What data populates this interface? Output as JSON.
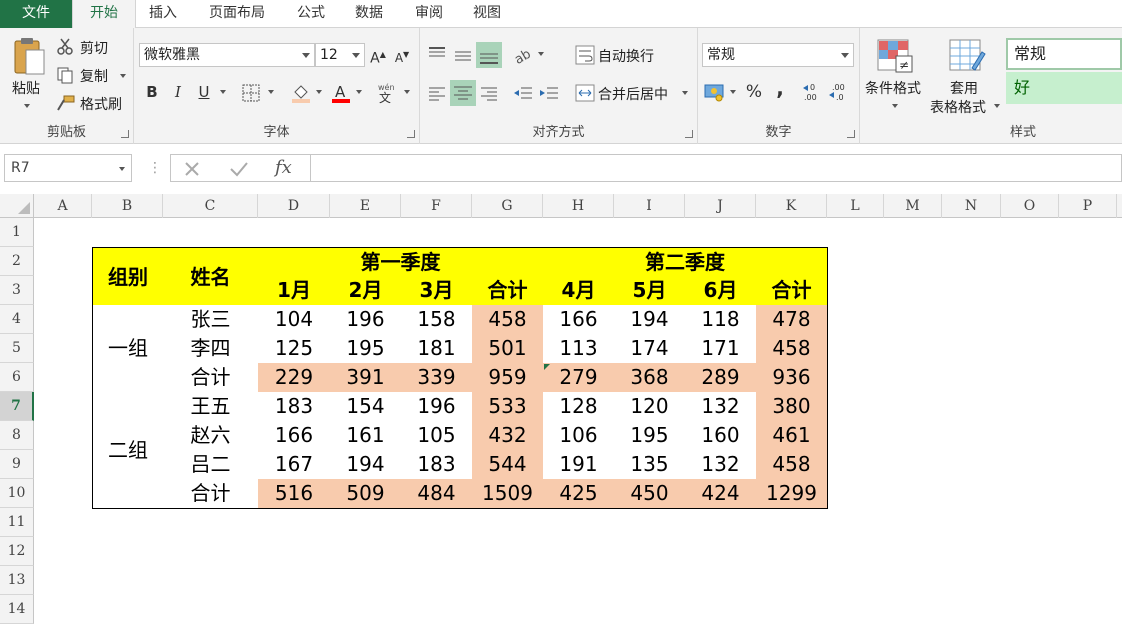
{
  "tabs": [
    "文件",
    "开始",
    "插入",
    "页面布局",
    "公式",
    "数据",
    "审阅",
    "视图"
  ],
  "clipboard": {
    "paste": "粘贴",
    "cut": "剪切",
    "copy": "复制",
    "format_painter": "格式刷",
    "group": "剪贴板"
  },
  "font": {
    "name": "微软雅黑",
    "size": "12",
    "group": "字体",
    "bold": "B",
    "italic": "I",
    "underline": "U"
  },
  "alignment": {
    "wrap": "自动换行",
    "merge": "合并后居中",
    "group": "对齐方式"
  },
  "number": {
    "format": "常规",
    "percent": "%",
    "comma": ",",
    "group": "数字"
  },
  "styles": {
    "conditional": "条件格式",
    "table_fmt_1": "套用",
    "table_fmt_2": "表格格式",
    "normal": "常规",
    "good": "好",
    "group": "样式"
  },
  "formula_bar": {
    "name_box": "R7",
    "fx": "fx",
    "value": ""
  },
  "columns": [
    "A",
    "B",
    "C",
    "D",
    "E",
    "F",
    "G",
    "H",
    "I",
    "J",
    "K",
    "L",
    "M",
    "N",
    "O",
    "P"
  ],
  "rows": [
    "1",
    "2",
    "3",
    "4",
    "5",
    "6",
    "7",
    "8",
    "9",
    "10",
    "11",
    "12",
    "13",
    "14"
  ],
  "active_row": "7",
  "table": {
    "h_group": "组别",
    "h_name": "姓名",
    "q1": "第一季度",
    "q2": "第二季度",
    "months": [
      "1月",
      "2月",
      "3月",
      "合计",
      "4月",
      "5月",
      "6月",
      "合计"
    ],
    "groups": [
      {
        "label": "一组",
        "rows": [
          {
            "name": "张三",
            "values": [
              "104",
              "196",
              "158",
              "458",
              "166",
              "194",
              "118",
              "478"
            ]
          },
          {
            "name": "李四",
            "values": [
              "125",
              "195",
              "181",
              "501",
              "113",
              "174",
              "171",
              "458"
            ]
          },
          {
            "name": "合计",
            "values": [
              "229",
              "391",
              "339",
              "959",
              "279",
              "368",
              "289",
              "936"
            ]
          }
        ]
      },
      {
        "label": "二组",
        "rows": [
          {
            "name": "王五",
            "values": [
              "183",
              "154",
              "196",
              "533",
              "128",
              "120",
              "132",
              "380"
            ]
          },
          {
            "name": "赵六",
            "values": [
              "166",
              "161",
              "105",
              "432",
              "106",
              "195",
              "160",
              "461"
            ]
          },
          {
            "name": "吕二",
            "values": [
              "167",
              "194",
              "183",
              "544",
              "191",
              "135",
              "132",
              "458"
            ]
          },
          {
            "name": "合计",
            "values": [
              "516",
              "509",
              "484",
              "1509",
              "425",
              "450",
              "424",
              "1299"
            ]
          }
        ]
      }
    ]
  },
  "colors": {
    "accent": "#217346",
    "header_fill": "#ffff00",
    "total_fill": "#f8cbad",
    "good_fill": "#c6efce"
  }
}
